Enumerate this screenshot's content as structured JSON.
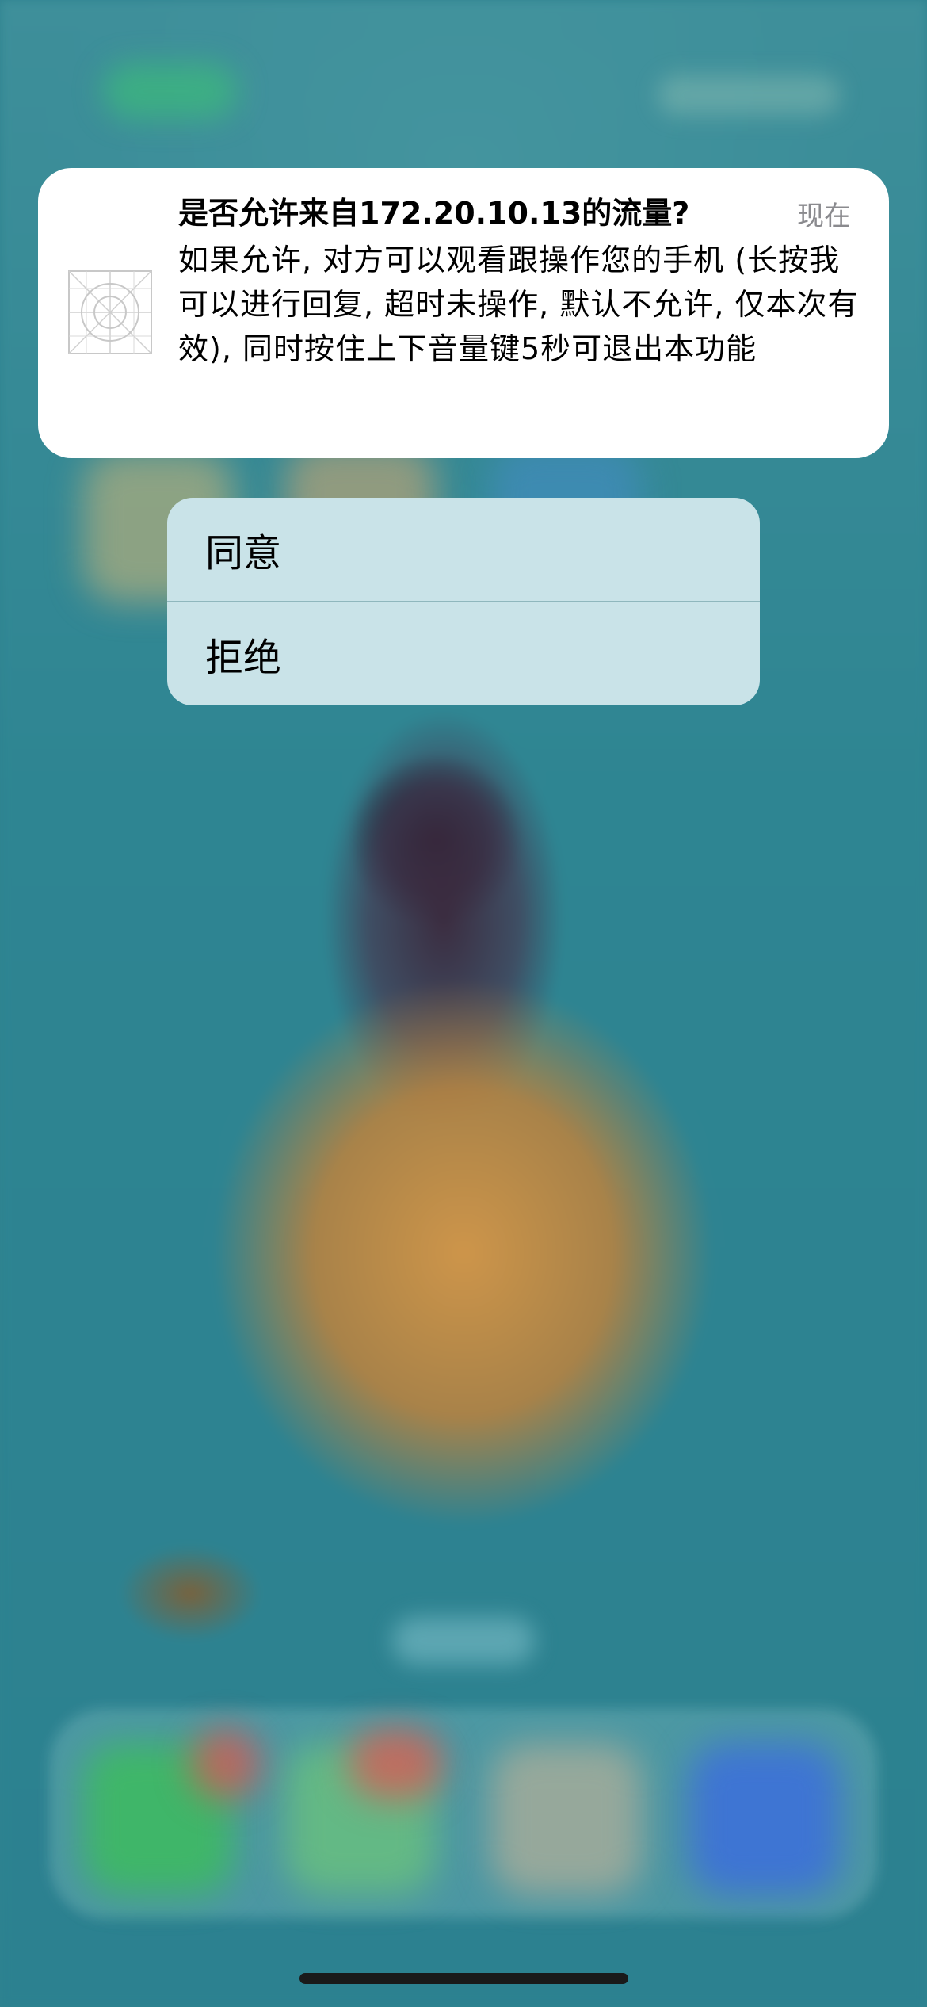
{
  "notification": {
    "app_icon": "app-placeholder-icon",
    "title": "是否允许来自172.20.10.13的流量?",
    "time": "现在",
    "body": "如果允许, 对方可以观看跟操作您的手机 (长按我可以进行回复, 超时未操作, 默认不允许, 仅本次有效), 同时按住上下音量键5秒可退出本功能"
  },
  "actions": {
    "agree_label": "同意",
    "reject_label": "拒绝"
  },
  "colors": {
    "wallpaper": "#2f8390",
    "banner": "#ffffff",
    "menu": "#c9e3e8",
    "time_text": "#8a8a8e"
  }
}
